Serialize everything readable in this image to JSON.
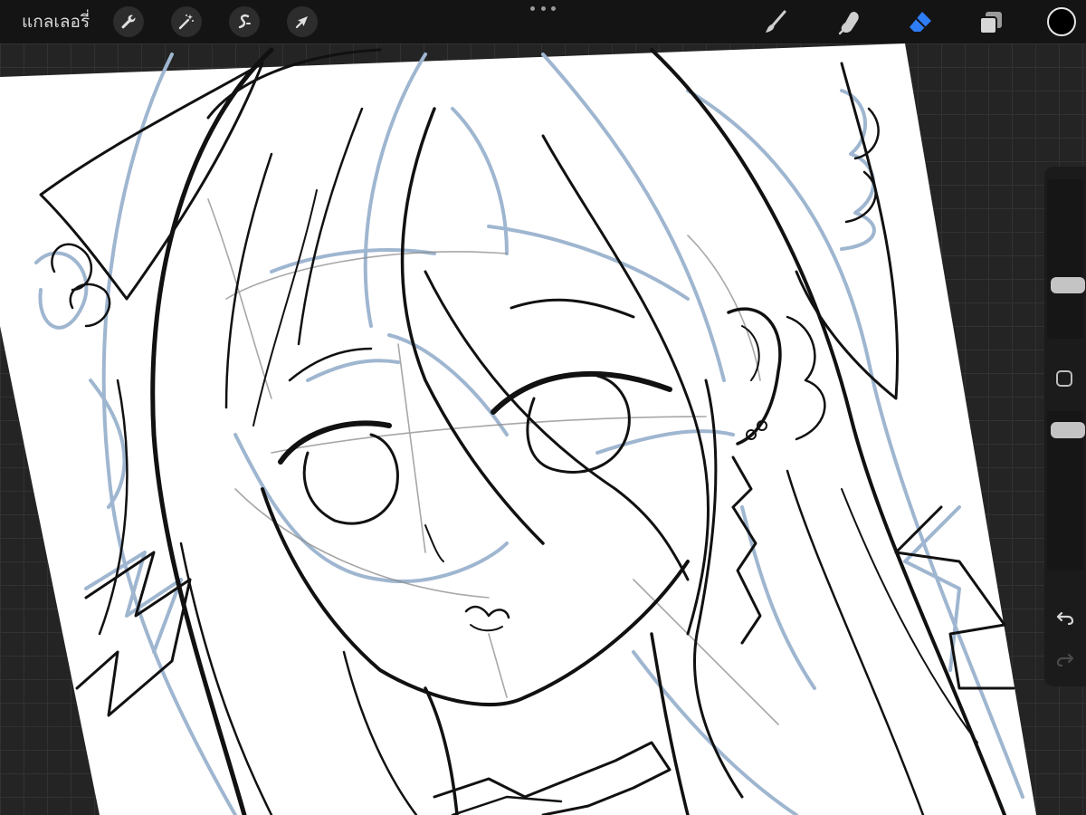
{
  "app": {
    "gallery_label": "แกลเลอรี่"
  },
  "toolbar_left": [
    {
      "name": "actions-button",
      "icon": "wrench-icon"
    },
    {
      "name": "adjustments-button",
      "icon": "magic-wand-icon"
    },
    {
      "name": "selection-button",
      "icon": "selection-s-icon"
    },
    {
      "name": "transform-button",
      "icon": "arrow-cursor-icon"
    }
  ],
  "toolbar_right": [
    {
      "name": "brush-tool",
      "icon": "brush-icon",
      "active": false
    },
    {
      "name": "smudge-tool",
      "icon": "smudge-finger-icon",
      "active": false
    },
    {
      "name": "eraser-tool",
      "icon": "eraser-icon",
      "active": true
    },
    {
      "name": "layers-button",
      "icon": "layers-icon",
      "active": false
    }
  ],
  "colors": {
    "topbar": "#141414",
    "workspace": "#242424",
    "active_tool": "#2f7df6",
    "icon": "#cfcfcf",
    "current_color": "#000000",
    "sketch_blue": "#9fb6d0",
    "ink": "#111111"
  },
  "sidebar": {
    "brush_size_level": 0.5,
    "opacity_level": 0.05
  }
}
